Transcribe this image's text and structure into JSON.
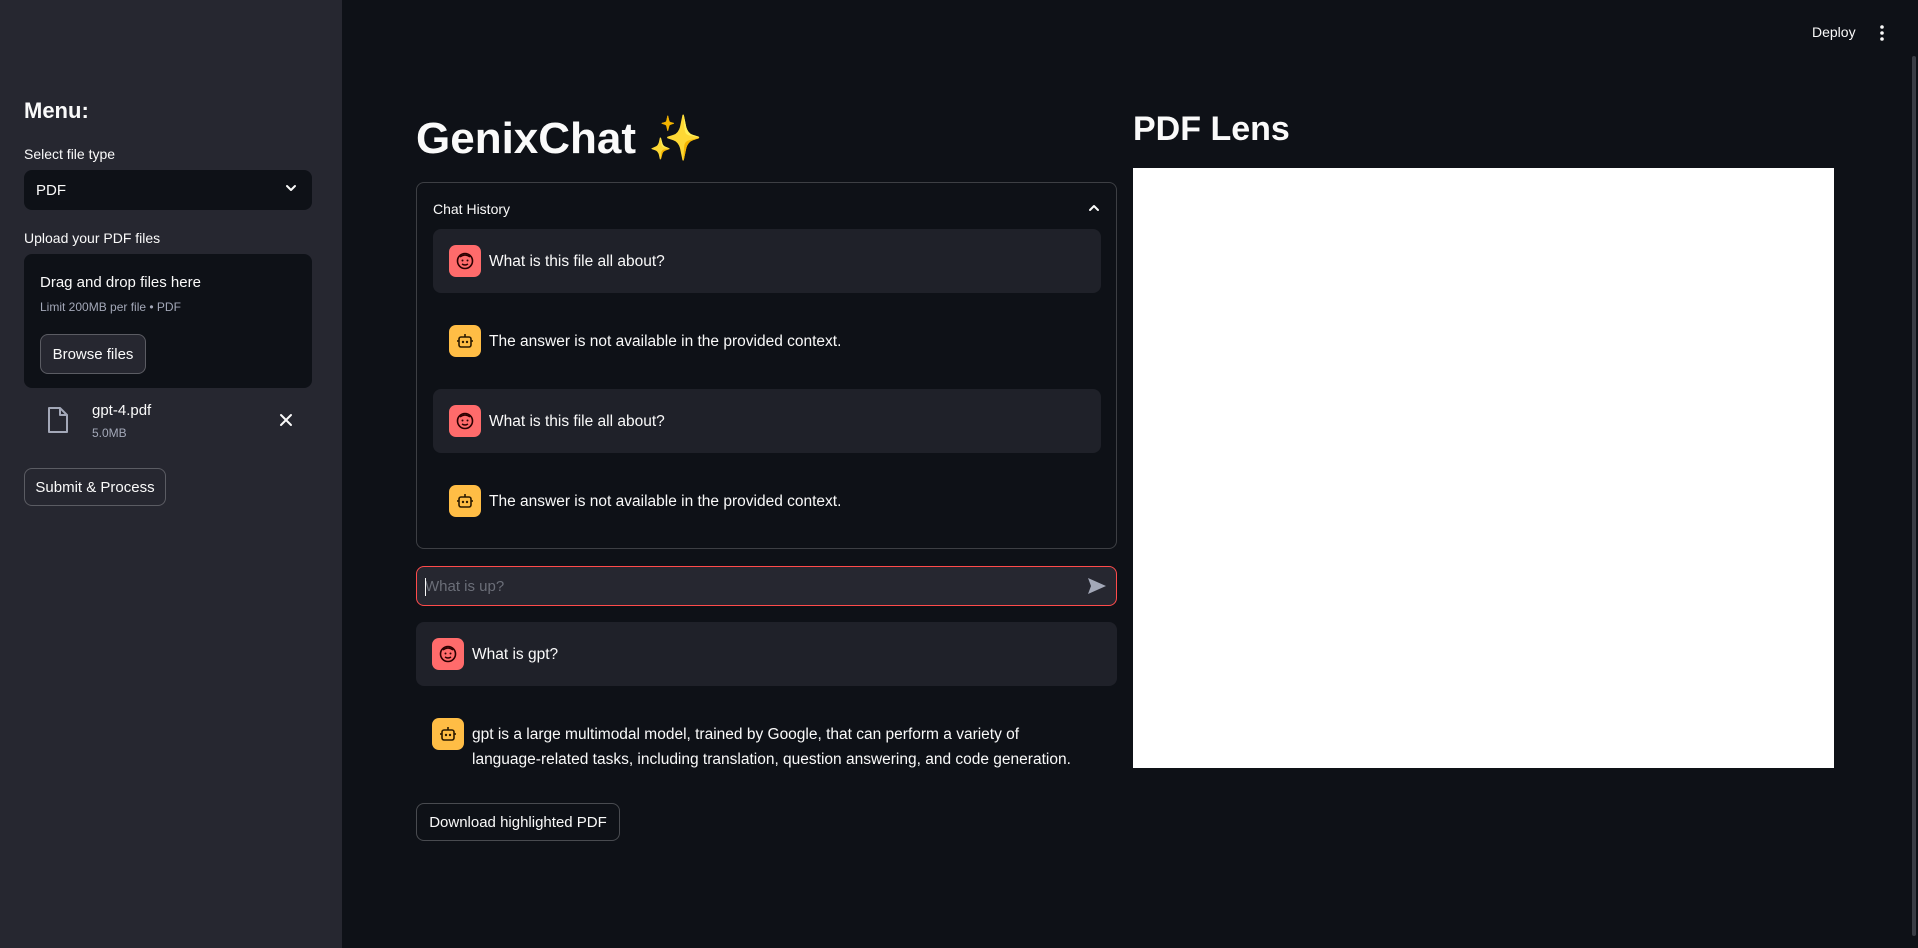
{
  "header": {
    "deploy_label": "Deploy"
  },
  "sidebar": {
    "title": "Menu:",
    "file_type_label": "Select file type",
    "file_type_value": "PDF",
    "upload_label": "Upload your PDF files",
    "dropzone": {
      "title": "Drag and drop files here",
      "limit": "Limit 200MB per file • PDF",
      "browse_label": "Browse files"
    },
    "uploaded_file": {
      "name": "gpt-4.pdf",
      "size": "5.0MB"
    },
    "submit_label": "Submit & Process"
  },
  "main": {
    "title": "GenixChat ✨",
    "history": {
      "label": "Chat History",
      "messages": [
        {
          "role": "user",
          "text": "What is this file all about?"
        },
        {
          "role": "assistant",
          "text": "The answer is not available in the provided context."
        },
        {
          "role": "user",
          "text": "What is this file all about?"
        },
        {
          "role": "assistant",
          "text": "The answer is not available in the provided context."
        }
      ]
    },
    "chat_input": {
      "placeholder": "What is up?",
      "value": ""
    },
    "current": [
      {
        "role": "user",
        "text": "What is gpt?"
      },
      {
        "role": "assistant",
        "text": "gpt is a large multimodal model, trained by Google, that can perform a variety of language-related tasks, including translation, question answering, and code generation."
      }
    ],
    "download_label": "Download highlighted PDF"
  },
  "pdf_lens": {
    "title": "PDF Lens"
  },
  "colors": {
    "background": "#0e1117",
    "sidebar": "#262730",
    "accent": "#ff4b4b",
    "user_avatar": "#ff6b6b",
    "assistant_avatar": "#ffbd45"
  },
  "icons": [
    "chevron-down-icon",
    "file-icon",
    "close-icon",
    "chevron-up-icon",
    "user-face-icon",
    "robot-icon",
    "send-icon",
    "kebab-menu-icon"
  ]
}
